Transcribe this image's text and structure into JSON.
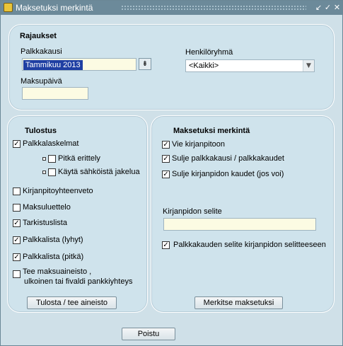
{
  "window": {
    "title": "Maksetuksi merkintä",
    "icon": "window-app-icon",
    "controls": {
      "minimize": "↙",
      "maximize": "✓",
      "close": "✕"
    }
  },
  "rajaukset": {
    "heading": "Rajaukset",
    "palkkakausi_label": "Palkkakausi",
    "palkkakausi_value": "Tammikuu 2013",
    "palkkakausi_button": "⇟",
    "henkiloryhma_label": "Henkilöryhmä",
    "henkiloryhma_value": "<Kaikki>",
    "maksupaiva_label": "Maksupäivä",
    "maksupaiva_value": ""
  },
  "tulostus": {
    "heading": "Tulostus",
    "items": [
      {
        "label": "Palkkalaskelmat",
        "checked": true
      },
      {
        "label": "Pitkä erittely",
        "checked": false
      },
      {
        "label": "Käytä sähköistä jakelua",
        "checked": false
      },
      {
        "label": "Kirjanpitoyhteenveto",
        "checked": false
      },
      {
        "label": "Maksuluettelo",
        "checked": false
      },
      {
        "label": "Tarkistuslista",
        "checked": true
      },
      {
        "label": "Palkkalista (lyhyt)",
        "checked": true
      },
      {
        "label": "Palkkalista (pitkä)",
        "checked": true
      },
      {
        "label": "Tee maksuaineisto ,",
        "label2": "ulkoinen tai fivaldi pankkiyhteys",
        "checked": false
      }
    ],
    "button": "Tulosta / tee aineisto"
  },
  "merkinta": {
    "heading": "Maksetuksi merkintä",
    "items": [
      {
        "label": "Vie kirjanpitoon",
        "checked": true
      },
      {
        "label": "Sulje palkkakausi / palkkakaudet",
        "checked": true
      },
      {
        "label": "Sulje kirjanpidon kaudet (jos voi)",
        "checked": true
      }
    ],
    "selite_label": "Kirjanpidon selite",
    "selite_value": "",
    "selite_checkbox": {
      "label": "Palkkakauden selite kirjanpidon selitteeseen",
      "checked": true
    },
    "button": "Merkitse maksetuksi"
  },
  "footer": {
    "button": "Poistu"
  }
}
